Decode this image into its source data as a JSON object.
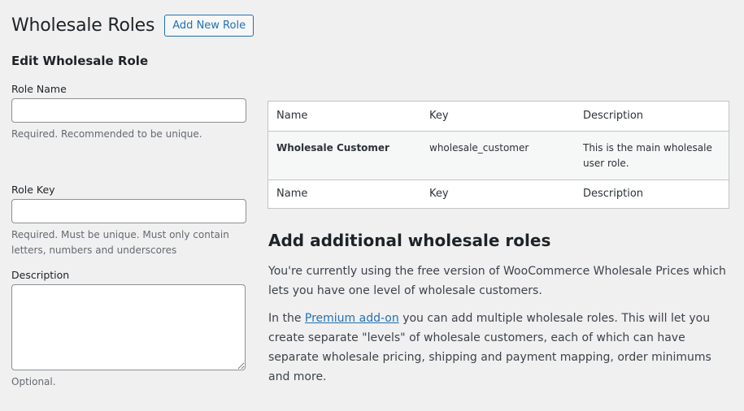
{
  "header": {
    "title": "Wholesale Roles",
    "add_new_label": "Add New Role"
  },
  "form": {
    "heading": "Edit Wholesale Role",
    "role_name": {
      "label": "Role Name",
      "value": "",
      "help": "Required. Recommended to be unique."
    },
    "role_key": {
      "label": "Role Key",
      "value": "",
      "help": "Required. Must be unique. Must only contain letters, numbers and underscores"
    },
    "description": {
      "label": "Description",
      "value": "",
      "help": "Optional."
    }
  },
  "table": {
    "columns": [
      "Name",
      "Key",
      "Description"
    ],
    "rows": [
      {
        "name": "Wholesale Customer",
        "key": "wholesale_customer",
        "description": "This is the main wholesale user role."
      }
    ]
  },
  "promo": {
    "heading": "Add additional wholesale roles",
    "paragraph1": "You're currently using the free version of WooCommerce Wholesale Prices which lets you have one level of wholesale customers.",
    "paragraph2_prefix": "In the ",
    "paragraph2_link": "Premium add-on",
    "paragraph2_suffix": " you can add multiple wholesale roles. This will let you create separate \"levels\" of wholesale customers, each of which can have separate wholesale pricing, shipping and payment mapping, order minimums and more."
  },
  "colors": {
    "accent": "#2271b1",
    "background": "#f0f0f1"
  }
}
